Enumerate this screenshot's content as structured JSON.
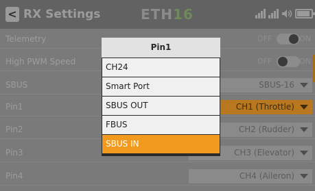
{
  "header": {
    "back_glyph": "<",
    "title": "RX Settings",
    "brand_main": "ETH",
    "brand_accent": "16",
    "status_icons": [
      "signal-icon",
      "signal-icon",
      "volume-icon",
      "battery-icon"
    ]
  },
  "rows": [
    {
      "label": "Telemetry",
      "control": "toggle",
      "state": "on",
      "off_label": "OFF",
      "on_label": "ON"
    },
    {
      "label": "High PWM Speed",
      "control": "toggle",
      "state": "off",
      "off_label": "OFF",
      "on_label": "ON"
    },
    {
      "label": "SBUS",
      "control": "select",
      "value": "SBUS-16"
    },
    {
      "label": "Pin1",
      "control": "select",
      "value": "CH1 (Throttle)",
      "highlighted": true
    },
    {
      "label": "Pin2",
      "control": "select",
      "value": "CH2 (Rudder)"
    },
    {
      "label": "Pin3",
      "control": "select",
      "value": "CH3 (Elevator)"
    },
    {
      "label": "Pin4",
      "control": "select",
      "value": "CH4 (Aileron)"
    }
  ],
  "popup": {
    "title": "Pin1",
    "options": [
      "CH24",
      "Smart Port",
      "SBUS OUT",
      "FBUS",
      "SBUS IN"
    ],
    "selected_index": 4
  },
  "colors": {
    "accent": "#f29a1e",
    "highlight_row": "#b9781f"
  }
}
